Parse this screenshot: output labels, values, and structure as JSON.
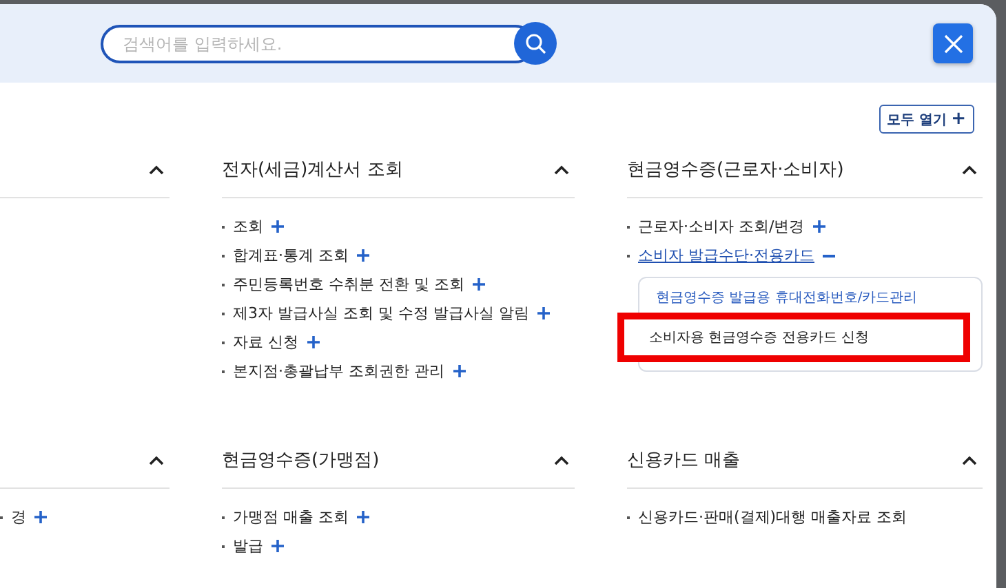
{
  "search": {
    "placeholder": "검색어를 입력하세요."
  },
  "expand_all": {
    "label": "모두 열기",
    "icon": "+"
  },
  "sections": [
    {
      "expanded": true
    },
    {
      "title": "전자(세금)계산서 조회",
      "expanded": true,
      "items": [
        {
          "label": "조회",
          "kind": "expandable",
          "expanded": false
        },
        {
          "label": "합계표·통계 조회",
          "kind": "expandable",
          "expanded": false
        },
        {
          "label": "주민등록번호 수취분 전환 및 조회",
          "kind": "expandable",
          "expanded": false
        },
        {
          "label": "제3자 발급사실 조회 및 수정 발급사실 알림",
          "kind": "expandable",
          "expanded": false
        },
        {
          "label": "자료 신청",
          "kind": "expandable",
          "expanded": false
        },
        {
          "label": "본지점·총괄납부 조회권한 관리",
          "kind": "expandable",
          "expanded": false
        }
      ]
    },
    {
      "title": "현금영수증(근로자·소비자)",
      "expanded": true,
      "items": [
        {
          "label": "근로자·소비자 조회/변경",
          "kind": "expandable",
          "expanded": false
        },
        {
          "label": "소비자 발급수단·전용카드",
          "kind": "expandable",
          "expanded": true,
          "children": [
            {
              "label": "현금영수증 발급용 휴대전화번호/카드관리",
              "highlighted": false
            },
            {
              "label": "소비자용 현금영수증 전용카드 신청",
              "highlighted": true
            }
          ]
        }
      ]
    },
    {
      "expanded": true,
      "items": [
        {
          "label": "경",
          "kind": "expandable",
          "expanded": false
        }
      ]
    },
    {
      "title": "현금영수증(가맹점)",
      "expanded": true,
      "items": [
        {
          "label": "가맹점 매출 조회",
          "kind": "expandable",
          "expanded": false
        },
        {
          "label": "발급",
          "kind": "expandable",
          "expanded": false
        }
      ]
    },
    {
      "title": "신용카드 매출",
      "expanded": true,
      "items": [
        {
          "label": "신용카드·판매(결제)대행 매출자료 조회",
          "kind": "plain",
          "expanded": false
        }
      ]
    }
  ]
}
